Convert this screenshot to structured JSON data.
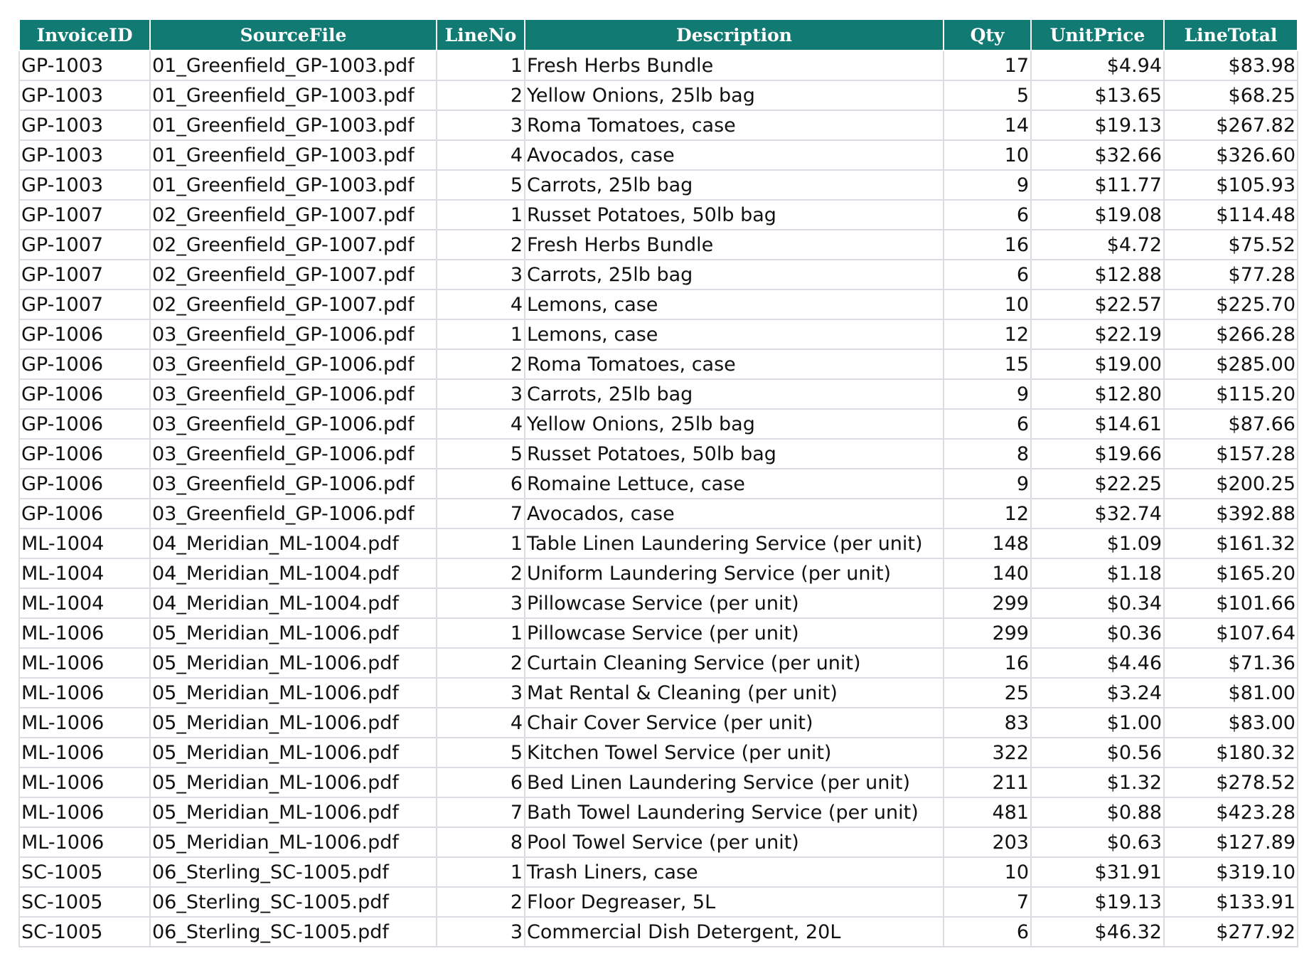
{
  "table": {
    "columns": [
      "InvoiceID",
      "SourceFile",
      "LineNo",
      "Description",
      "Qty",
      "UnitPrice",
      "LineTotal"
    ],
    "rows": [
      [
        "GP-1003",
        "01_Greenfield_GP-1003.pdf",
        "1",
        "Fresh Herbs Bundle",
        "17",
        "$4.94",
        "$83.98"
      ],
      [
        "GP-1003",
        "01_Greenfield_GP-1003.pdf",
        "2",
        "Yellow Onions, 25lb bag",
        "5",
        "$13.65",
        "$68.25"
      ],
      [
        "GP-1003",
        "01_Greenfield_GP-1003.pdf",
        "3",
        "Roma Tomatoes, case",
        "14",
        "$19.13",
        "$267.82"
      ],
      [
        "GP-1003",
        "01_Greenfield_GP-1003.pdf",
        "4",
        "Avocados, case",
        "10",
        "$32.66",
        "$326.60"
      ],
      [
        "GP-1003",
        "01_Greenfield_GP-1003.pdf",
        "5",
        "Carrots, 25lb bag",
        "9",
        "$11.77",
        "$105.93"
      ],
      [
        "GP-1007",
        "02_Greenfield_GP-1007.pdf",
        "1",
        "Russet Potatoes, 50lb bag",
        "6",
        "$19.08",
        "$114.48"
      ],
      [
        "GP-1007",
        "02_Greenfield_GP-1007.pdf",
        "2",
        "Fresh Herbs Bundle",
        "16",
        "$4.72",
        "$75.52"
      ],
      [
        "GP-1007",
        "02_Greenfield_GP-1007.pdf",
        "3",
        "Carrots, 25lb bag",
        "6",
        "$12.88",
        "$77.28"
      ],
      [
        "GP-1007",
        "02_Greenfield_GP-1007.pdf",
        "4",
        "Lemons, case",
        "10",
        "$22.57",
        "$225.70"
      ],
      [
        "GP-1006",
        "03_Greenfield_GP-1006.pdf",
        "1",
        "Lemons, case",
        "12",
        "$22.19",
        "$266.28"
      ],
      [
        "GP-1006",
        "03_Greenfield_GP-1006.pdf",
        "2",
        "Roma Tomatoes, case",
        "15",
        "$19.00",
        "$285.00"
      ],
      [
        "GP-1006",
        "03_Greenfield_GP-1006.pdf",
        "3",
        "Carrots, 25lb bag",
        "9",
        "$12.80",
        "$115.20"
      ],
      [
        "GP-1006",
        "03_Greenfield_GP-1006.pdf",
        "4",
        "Yellow Onions, 25lb bag",
        "6",
        "$14.61",
        "$87.66"
      ],
      [
        "GP-1006",
        "03_Greenfield_GP-1006.pdf",
        "5",
        "Russet Potatoes, 50lb bag",
        "8",
        "$19.66",
        "$157.28"
      ],
      [
        "GP-1006",
        "03_Greenfield_GP-1006.pdf",
        "6",
        "Romaine Lettuce, case",
        "9",
        "$22.25",
        "$200.25"
      ],
      [
        "GP-1006",
        "03_Greenfield_GP-1006.pdf",
        "7",
        "Avocados, case",
        "12",
        "$32.74",
        "$392.88"
      ],
      [
        "ML-1004",
        "04_Meridian_ML-1004.pdf",
        "1",
        "Table Linen Laundering Service (per unit)",
        "148",
        "$1.09",
        "$161.32"
      ],
      [
        "ML-1004",
        "04_Meridian_ML-1004.pdf",
        "2",
        "Uniform Laundering Service (per unit)",
        "140",
        "$1.18",
        "$165.20"
      ],
      [
        "ML-1004",
        "04_Meridian_ML-1004.pdf",
        "3",
        "Pillowcase Service (per unit)",
        "299",
        "$0.34",
        "$101.66"
      ],
      [
        "ML-1006",
        "05_Meridian_ML-1006.pdf",
        "1",
        "Pillowcase Service (per unit)",
        "299",
        "$0.36",
        "$107.64"
      ],
      [
        "ML-1006",
        "05_Meridian_ML-1006.pdf",
        "2",
        "Curtain Cleaning Service (per unit)",
        "16",
        "$4.46",
        "$71.36"
      ],
      [
        "ML-1006",
        "05_Meridian_ML-1006.pdf",
        "3",
        "Mat Rental & Cleaning (per unit)",
        "25",
        "$3.24",
        "$81.00"
      ],
      [
        "ML-1006",
        "05_Meridian_ML-1006.pdf",
        "4",
        "Chair Cover Service (per unit)",
        "83",
        "$1.00",
        "$83.00"
      ],
      [
        "ML-1006",
        "05_Meridian_ML-1006.pdf",
        "5",
        "Kitchen Towel Service (per unit)",
        "322",
        "$0.56",
        "$180.32"
      ],
      [
        "ML-1006",
        "05_Meridian_ML-1006.pdf",
        "6",
        "Bed Linen Laundering Service (per unit)",
        "211",
        "$1.32",
        "$278.52"
      ],
      [
        "ML-1006",
        "05_Meridian_ML-1006.pdf",
        "7",
        "Bath Towel Laundering Service (per unit)",
        "481",
        "$0.88",
        "$423.28"
      ],
      [
        "ML-1006",
        "05_Meridian_ML-1006.pdf",
        "8",
        "Pool Towel Service (per unit)",
        "203",
        "$0.63",
        "$127.89"
      ],
      [
        "SC-1005",
        "06_Sterling_SC-1005.pdf",
        "1",
        "Trash Liners, case",
        "10",
        "$31.91",
        "$319.10"
      ],
      [
        "SC-1005",
        "06_Sterling_SC-1005.pdf",
        "2",
        "Floor Degreaser, 5L",
        "7",
        "$19.13",
        "$133.91"
      ],
      [
        "SC-1005",
        "06_Sterling_SC-1005.pdf",
        "3",
        "Commercial Dish Detergent, 20L",
        "6",
        "$46.32",
        "$277.92"
      ]
    ]
  },
  "colors": {
    "header_bg": "#117a73",
    "header_text": "#ffffff",
    "grid": "#d9dde2"
  }
}
